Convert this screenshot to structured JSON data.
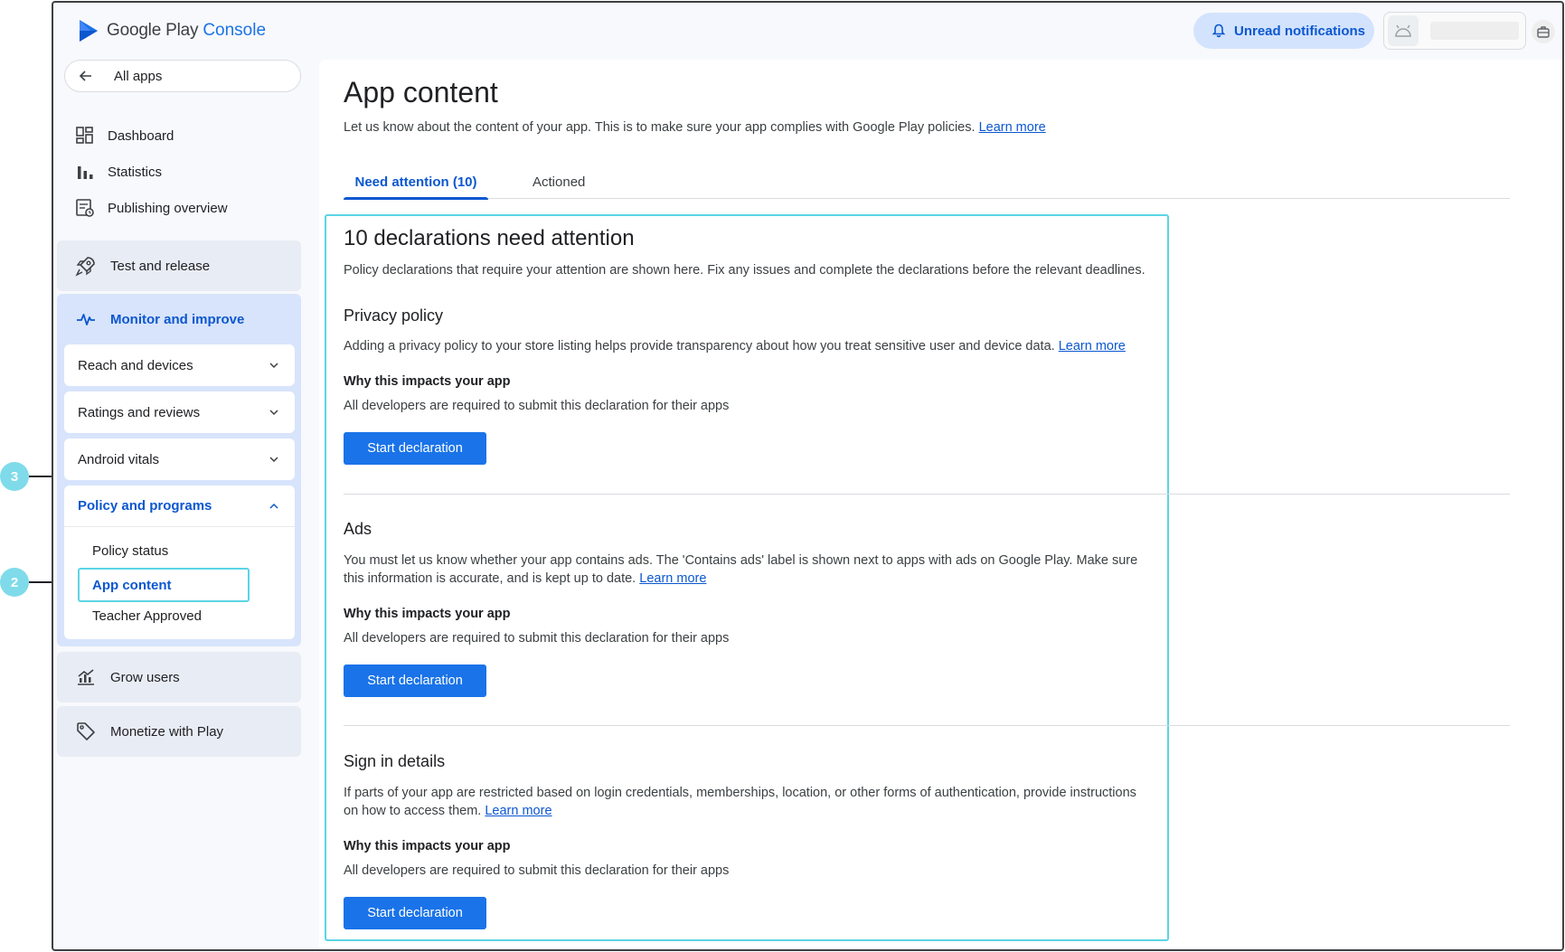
{
  "header": {
    "logo_google_play": "Google Play",
    "logo_console": "Console",
    "notifications_label": "Unread notifications"
  },
  "sidebar": {
    "all_apps": "All apps",
    "items": [
      {
        "label": "Dashboard",
        "icon": "dashboard-icon"
      },
      {
        "label": "Statistics",
        "icon": "bar-chart-icon"
      },
      {
        "label": "Publishing overview",
        "icon": "publishing-overview-icon"
      }
    ],
    "test_and_release": "Test and release",
    "monitor_and_improve": "Monitor and improve",
    "monitor_sub": [
      {
        "label": "Reach and devices"
      },
      {
        "label": "Ratings and reviews"
      },
      {
        "label": "Android vitals"
      }
    ],
    "policy_and_programs": "Policy and programs",
    "policy_sub": [
      {
        "label": "Policy status"
      },
      {
        "label": "App content"
      },
      {
        "label": "Teacher Approved"
      }
    ],
    "grow_users": "Grow users",
    "monetize": "Monetize with Play"
  },
  "main": {
    "title": "App content",
    "description": "Let us know about the content of your app. This is to make sure your app complies with Google Play policies.",
    "learn_more": "Learn more",
    "tabs": [
      {
        "label": "Need attention (10)",
        "active": true
      },
      {
        "label": "Actioned",
        "active": false
      }
    ],
    "attention_title": "10 declarations need attention",
    "attention_desc": "Policy declarations that require your attention are shown here. Fix any issues and complete the declarations before the relevant deadlines.",
    "declarations": [
      {
        "title": "Privacy policy",
        "desc": "Adding a privacy policy to your store listing helps provide transparency about how you treat sensitive user and device data.",
        "link": "Learn more",
        "why": "Why this impacts your app",
        "requirement": "All developers are required to submit this declaration for their apps",
        "button": "Start declaration"
      },
      {
        "title": "Ads",
        "desc": "You must let us know whether your app contains ads. The 'Contains ads' label is shown next to apps with ads on Google Play. Make sure this information is accurate, and is kept up to date.",
        "link": "Learn more",
        "why": "Why this impacts your app",
        "requirement": "All developers are required to submit this declaration for their apps",
        "button": "Start declaration"
      },
      {
        "title": "Sign in details",
        "desc": "If parts of your app are restricted based on login credentials, memberships, location, or other forms of authentication, provide instructions on how to access them.",
        "link": "Learn more",
        "why": "Why this impacts your app",
        "requirement": "All developers are required to submit this declaration for their apps",
        "button": "Start declaration"
      }
    ]
  },
  "callouts": [
    {
      "number": "3"
    },
    {
      "number": "2"
    }
  ],
  "colors": {
    "accent": "#1a73e8",
    "link": "#0b57d0",
    "highlight": "#5bd4e6",
    "callout": "#7fdbea"
  }
}
